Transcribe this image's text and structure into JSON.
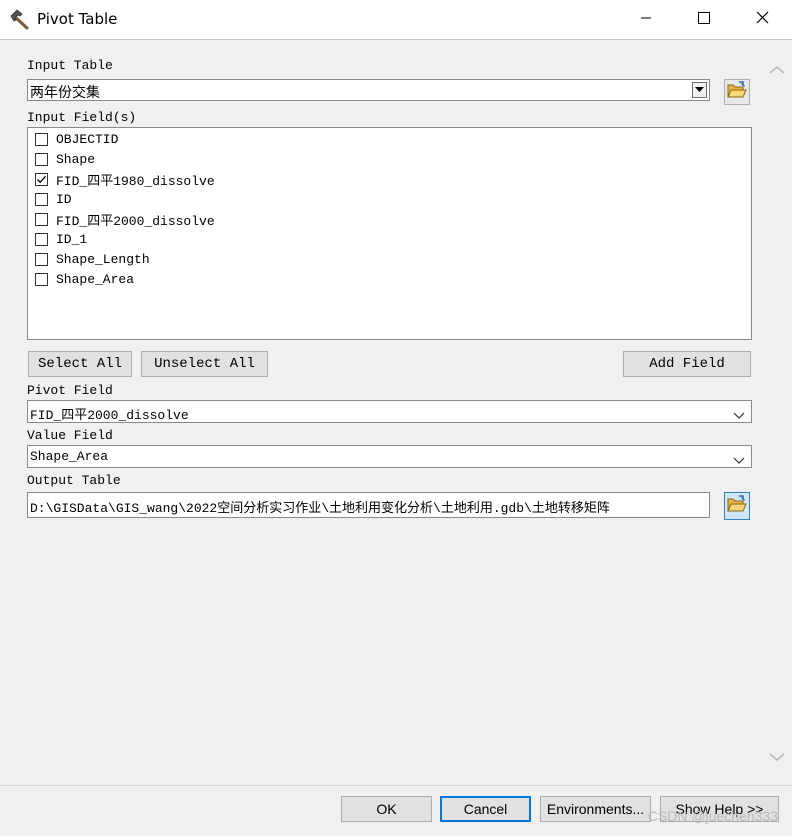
{
  "window": {
    "title": "Pivot Table",
    "icon": "hammer-icon",
    "controls": [
      "minimize-icon",
      "maximize-icon",
      "close-icon"
    ]
  },
  "input_table": {
    "label": "Input Table",
    "value": "两年份交集",
    "browse_icon": "open-folder-icon"
  },
  "input_fields": {
    "label": "Input Field(s)",
    "items": [
      {
        "label": "OBJECTID",
        "checked": false
      },
      {
        "label": "Shape",
        "checked": false
      },
      {
        "label": "FID_四平1980_dissolve",
        "checked": true
      },
      {
        "label": "ID",
        "checked": false
      },
      {
        "label": "FID_四平2000_dissolve",
        "checked": false
      },
      {
        "label": "ID_1",
        "checked": false
      },
      {
        "label": "Shape_Length",
        "checked": false
      },
      {
        "label": "Shape_Area",
        "checked": false
      }
    ]
  },
  "buttons": {
    "select_all": "Select All",
    "unselect_all": "Unselect All",
    "add_field": "Add Field"
  },
  "pivot_field": {
    "label": "Pivot Field",
    "value": "FID_四平2000_dissolve"
  },
  "value_field": {
    "label": "Value Field",
    "value": "Shape_Area"
  },
  "output_table": {
    "label": "Output Table",
    "value": "D:\\GISData\\GIS_wang\\2022空间分析实习作业\\土地利用变化分析\\土地利用.gdb\\土地转移矩阵",
    "browse_icon": "open-folder-icon"
  },
  "footer": {
    "ok": "OK",
    "cancel": "Cancel",
    "environments": "Environments...",
    "show_help": "Show Help >>"
  },
  "watermark": "CSDN @juechen333"
}
